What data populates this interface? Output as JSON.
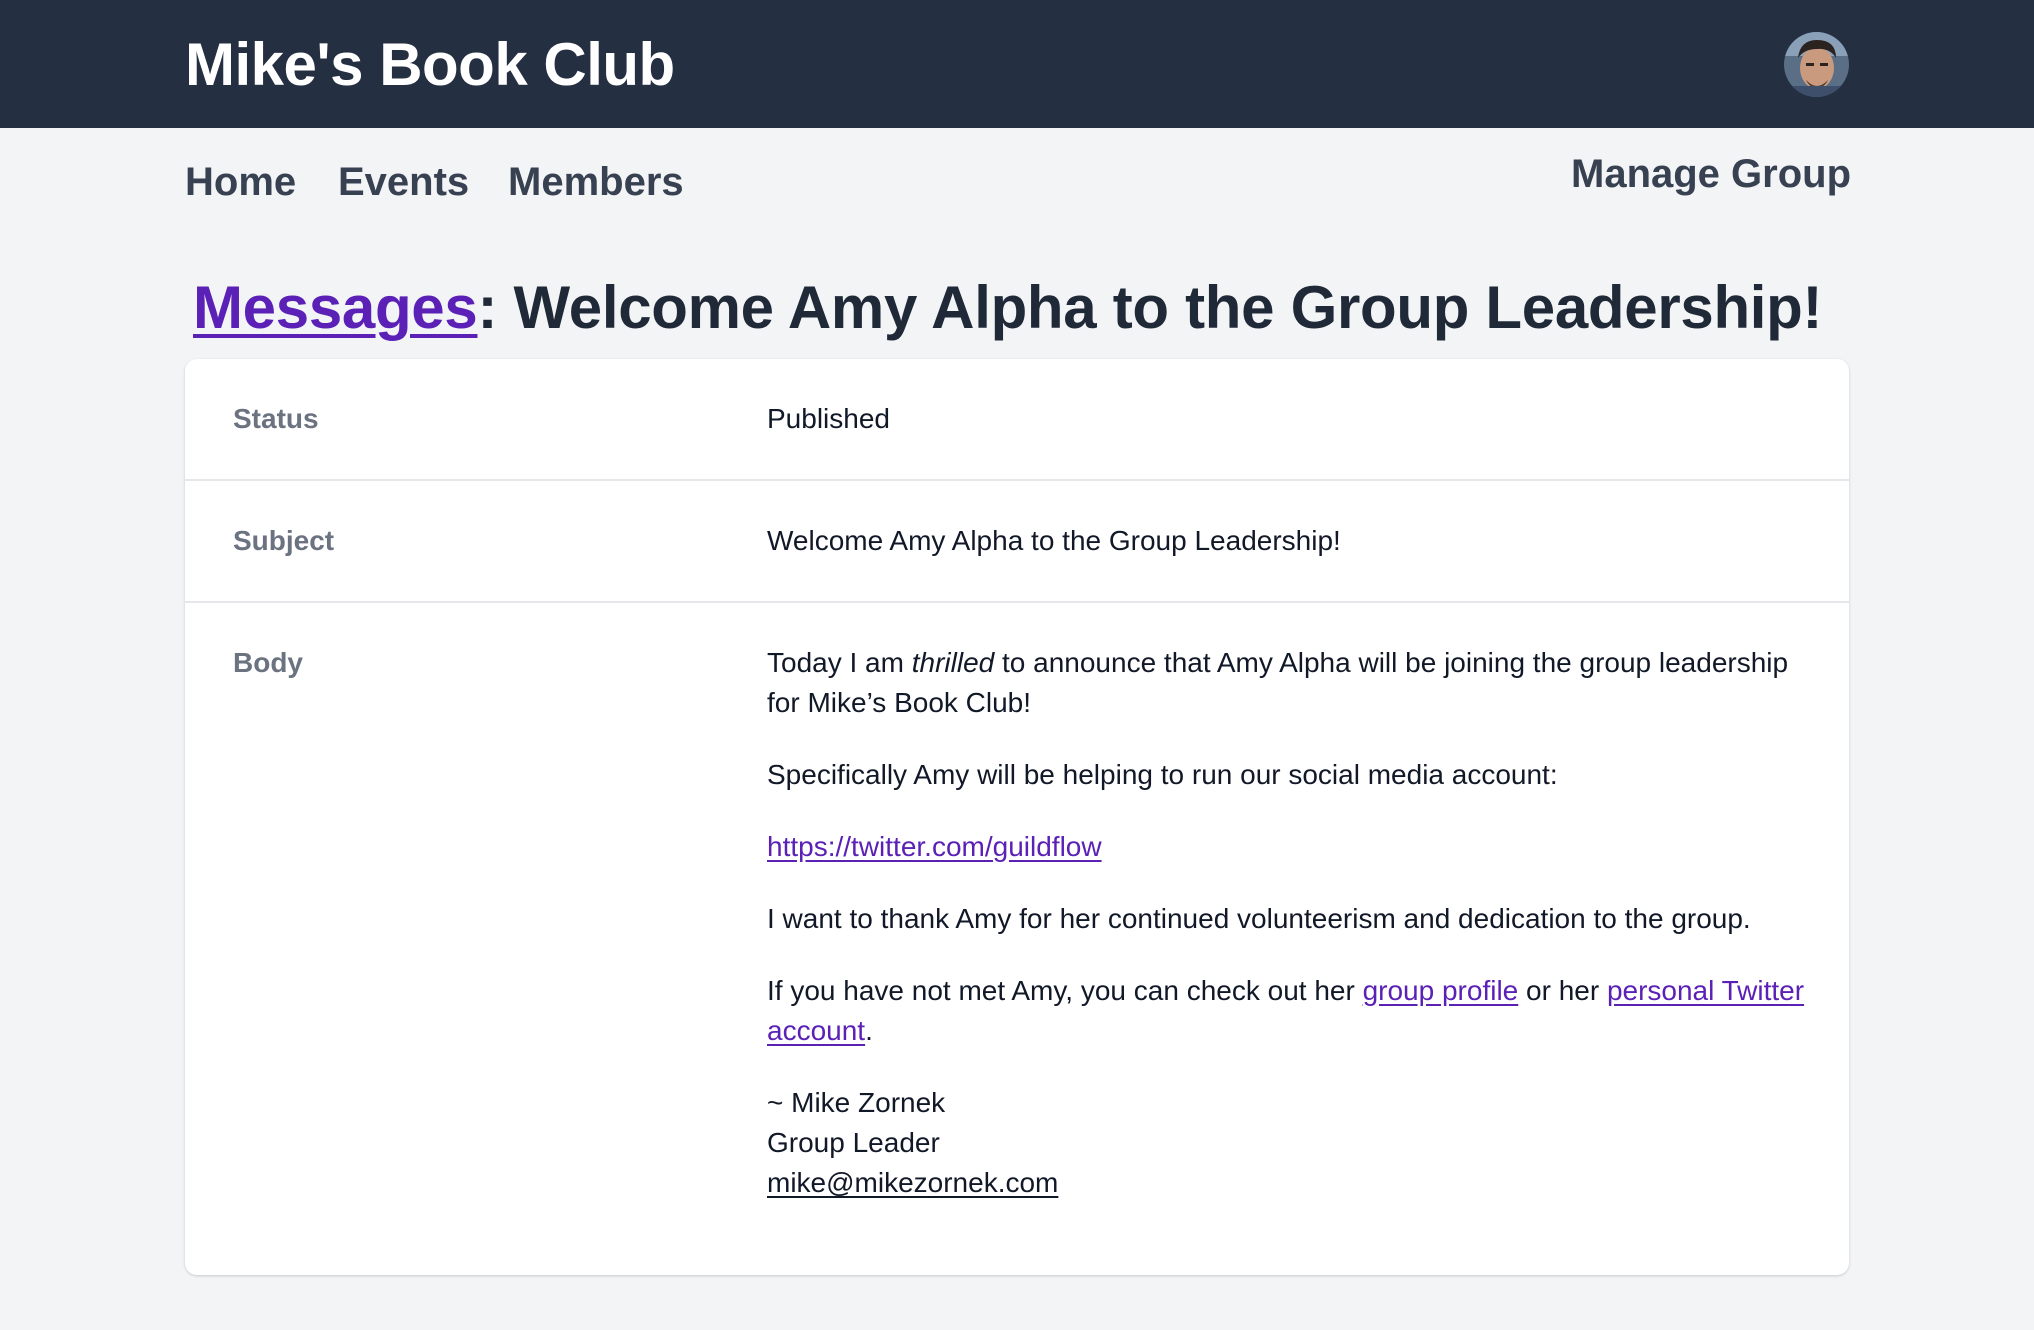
{
  "header": {
    "brand": "Mike's Book Club",
    "avatar_icon": "user-avatar-icon",
    "background_color": "#242f42"
  },
  "nav": {
    "home": "Home",
    "events": "Events",
    "members": "Members",
    "manage_group": "Manage Group"
  },
  "page": {
    "breadcrumb_link": "Messages",
    "title_rest": ": Welcome Amy Alpha to the Group Leadership!"
  },
  "message": {
    "status_label": "Status",
    "status_value": "Published",
    "subject_label": "Subject",
    "subject_value": "Welcome Amy Alpha to the Group Leadership!",
    "body_label": "Body",
    "body": {
      "p1_before": "Today I am ",
      "p1_em": "thrilled",
      "p1_after": " to announce that Amy Alpha will be joining the group leadership for Mike’s Book Club!",
      "p2": "Specifically Amy will be helping to run our social media account:",
      "p3_link": "https://twitter.com/guildflow",
      "p4": "I want to thank Amy for her continued volunteerism and dedication to the group.",
      "p5_before": "If you have not met Amy, you can check out her ",
      "p5_link1": "group profile",
      "p5_middle": " or her ",
      "p5_link2": "personal Twitter account",
      "p5_after": ".",
      "sig_name": "~ Mike Zornek",
      "sig_role": "Group Leader",
      "sig_email": "mike@mikezornek.com"
    }
  },
  "colors": {
    "link_purple": "#5b21b6",
    "page_bg": "#f3f4f6",
    "label_gray": "#6b7280"
  }
}
